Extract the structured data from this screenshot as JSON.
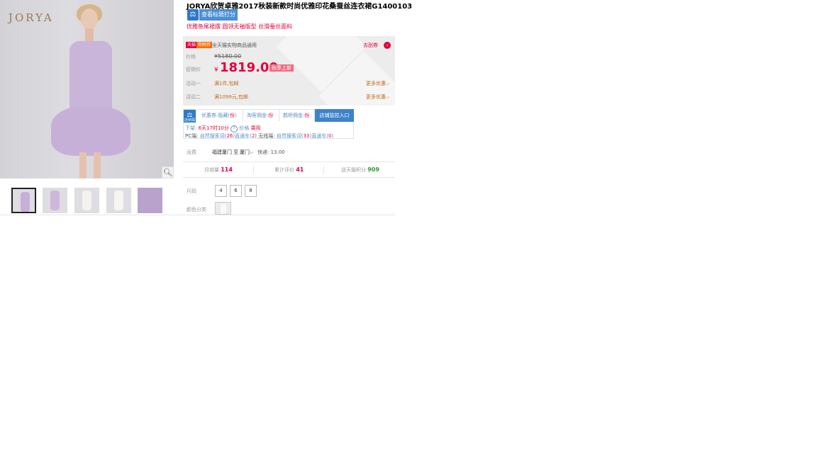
{
  "product": {
    "brand_logo": "JORYA",
    "title": "JORYA欣贺卓雅2017秋装新款时尚优雅印花桑蚕丝连衣裙G1400103",
    "rate_button": "查看标题打分",
    "subtitle": "优雅鱼尾裙摆 圆领无袖版型 丝滑蚕丝面料"
  },
  "price_panel": {
    "tmall_tag": "天猫",
    "shopping_tag": "购物券",
    "coupon_note": "全天猫实物商品通用",
    "coupon_link": "去刮券",
    "coupon_arrow": "›",
    "price_label": "价格",
    "original_price": "¥5180.00",
    "promo_label": "促销价",
    "promo_currency": "¥",
    "promo_price": "1819.00",
    "promo_badge": "秋季上新",
    "activity1_label": "活动一",
    "activity1_value": "满1件,包邮",
    "activity1_more": "更多优惠",
    "activity2_label": "活动二",
    "activity2_value": "满1099元,包邮",
    "activity2_more": "更多优惠"
  },
  "toolbar": {
    "icon_caption": "店侦探",
    "item1_prefix": "优惠券:隐藏(",
    "item1_num": "份",
    "item1_suffix": ")",
    "item2_prefix": "淘客佣金:",
    "item2_num": "份",
    "item3_prefix": "鹊桥佣金:",
    "item3_num": "份",
    "shop_button": "店铺监控入口",
    "line2_prefix": "下架: ",
    "line2_time": "6天17时10分",
    "line2_help": "?",
    "line2_price_label": " 价格 ",
    "line2_price_link": "乘用",
    "line3_pc": "PC端: ",
    "line3_search": "自然搜索词(",
    "line3_search_num": "26",
    "line3_train": ")直通车(",
    "line3_train_num": "2",
    "line3_mid": ") 无线端: ",
    "line3_search2": "自然搜索词(",
    "line3_search2_num": "33",
    "line3_train2": ")直通车(",
    "line3_train2_num": "0",
    "line3_end": ")"
  },
  "shipping": {
    "label": "运费",
    "from": "福建厦门 至",
    "destination": "厦门",
    "cost": "快递: 13.00"
  },
  "stats": {
    "monthly_sales_label": "月销量",
    "monthly_sales": "114",
    "reviews_label": "累计评价",
    "reviews": "41",
    "points_label": "送天猫积分",
    "points": "909"
  },
  "options": {
    "size_label": "尺码",
    "sizes": [
      "4",
      "6",
      "8"
    ],
    "color_label": "颜色分类"
  },
  "colors": {
    "accent_red": "#e4003a",
    "tool_blue": "#3e83c9"
  }
}
